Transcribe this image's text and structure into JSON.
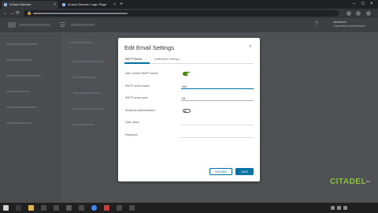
{
  "browser": {
    "tabs": [
      {
        "label": "vCloud Director",
        "active": true
      },
      {
        "label": "vCloud Director Login Page",
        "active": false
      }
    ],
    "new_tab": "+",
    "tab_close": "×",
    "window_controls": {
      "minimize": "–",
      "maximize": "□",
      "close": "×"
    },
    "nav": {
      "back": "←",
      "forward": "→",
      "reload": "⟳"
    },
    "lock": "🔒"
  },
  "app_header": {
    "menu_icon": "☰",
    "help_icon": "?",
    "user_name": "citadadmin",
    "user_role": "Organization Administrator"
  },
  "dialog": {
    "title": "Edit Email Settings",
    "close": "×",
    "tabs": [
      {
        "label": "SMTP Server",
        "active": true
      },
      {
        "label": "Notification Settings",
        "active": false
      }
    ],
    "fields": {
      "use_custom_smtp": {
        "label": "Use Custom SMTP server",
        "on": true,
        "check": "✓"
      },
      "smtp_server_name": {
        "label": "SMTP server name",
        "value": "smt"
      },
      "smtp_server_port": {
        "label": "SMTP server port",
        "value": "25"
      },
      "requires_auth": {
        "label": "Requires authentication",
        "on": false
      },
      "user_name": {
        "label": "User name",
        "value": ""
      },
      "password": {
        "label": "Password",
        "value": ""
      }
    },
    "buttons": {
      "discard": "DISCARD",
      "save": "SAVE"
    }
  },
  "watermark": {
    "text": "CITADEL",
    "sup": "NZ"
  },
  "colors": {
    "accent": "#0072a3",
    "toggle_on": "#3c8500",
    "watermark": "#8ac43f"
  }
}
